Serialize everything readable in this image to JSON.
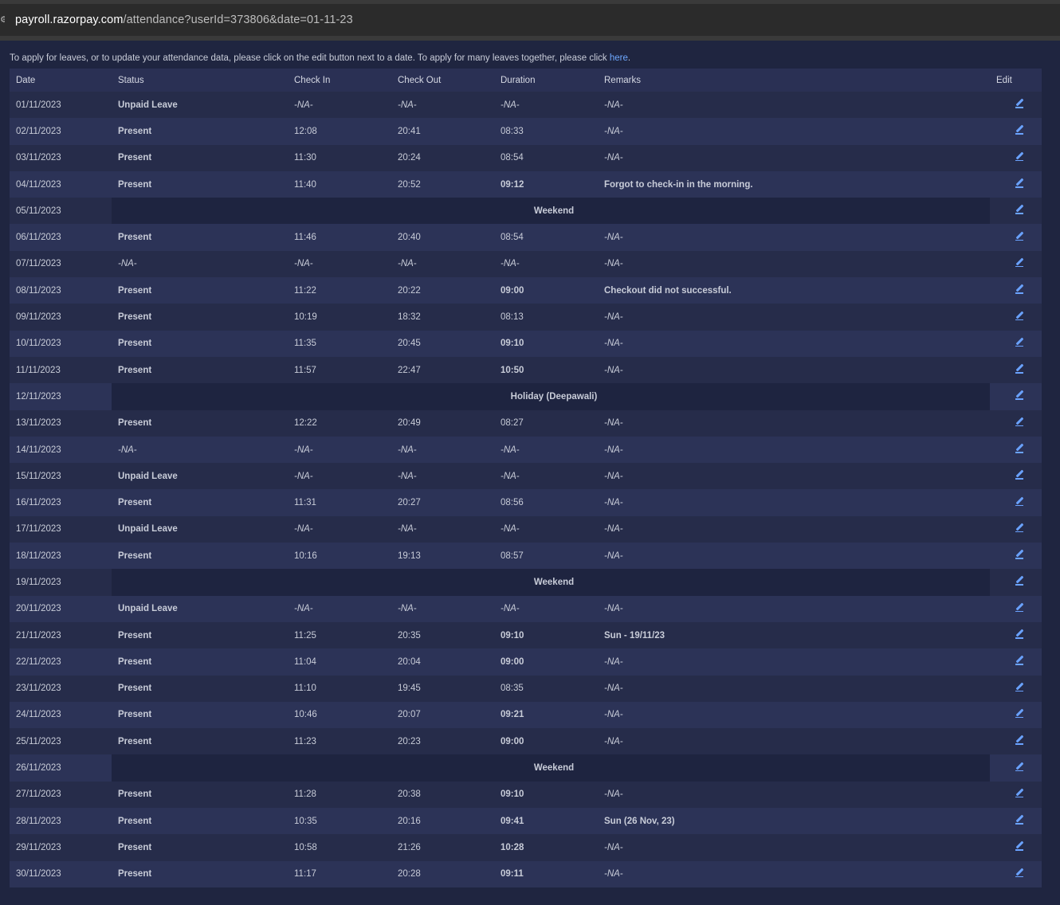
{
  "browser": {
    "url_domain": "payroll.razorpay.com",
    "url_path": "/attendance?userId=373806&date=01-11-23"
  },
  "notice": {
    "text": "To apply for leaves, or to update your attendance data, please click on the edit button next to a date. To apply for many leaves together, please click ",
    "link": "here",
    "end": "."
  },
  "table": {
    "headers": [
      "Date",
      "Status",
      "Check In",
      "Check Out",
      "Duration",
      "Remarks",
      "Edit"
    ],
    "rows": [
      {
        "date": "01/11/2023",
        "status": "Unpaid Leave",
        "in": "-NA-",
        "out": "-NA-",
        "dur": "-NA-",
        "remarks": "-NA-"
      },
      {
        "date": "02/11/2023",
        "status": "Present",
        "in": "12:08",
        "out": "20:41",
        "dur": "08:33",
        "remarks": "-NA-"
      },
      {
        "date": "03/11/2023",
        "status": "Present",
        "in": "11:30",
        "out": "20:24",
        "dur": "08:54",
        "remarks": "-NA-"
      },
      {
        "date": "04/11/2023",
        "status": "Present",
        "in": "11:40",
        "out": "20:52",
        "dur": "09:12",
        "remarks": "Forgot to check-in in the morning."
      },
      {
        "date": "05/11/2023",
        "special": "Weekend"
      },
      {
        "date": "06/11/2023",
        "status": "Present",
        "in": "11:46",
        "out": "20:40",
        "dur": "08:54",
        "remarks": "-NA-"
      },
      {
        "date": "07/11/2023",
        "status": "-NA-",
        "in": "-NA-",
        "out": "-NA-",
        "dur": "-NA-",
        "remarks": "-NA-"
      },
      {
        "date": "08/11/2023",
        "status": "Present",
        "in": "11:22",
        "out": "20:22",
        "dur": "09:00",
        "remarks": "Checkout did not successful."
      },
      {
        "date": "09/11/2023",
        "status": "Present",
        "in": "10:19",
        "out": "18:32",
        "dur": "08:13",
        "remarks": "-NA-"
      },
      {
        "date": "10/11/2023",
        "status": "Present",
        "in": "11:35",
        "out": "20:45",
        "dur": "09:10",
        "remarks": "-NA-"
      },
      {
        "date": "11/11/2023",
        "status": "Present",
        "in": "11:57",
        "out": "22:47",
        "dur": "10:50",
        "remarks": "-NA-"
      },
      {
        "date": "12/11/2023",
        "special": "Holiday (Deepawali)"
      },
      {
        "date": "13/11/2023",
        "status": "Present",
        "in": "12:22",
        "out": "20:49",
        "dur": "08:27",
        "remarks": "-NA-"
      },
      {
        "date": "14/11/2023",
        "status": "-NA-",
        "in": "-NA-",
        "out": "-NA-",
        "dur": "-NA-",
        "remarks": "-NA-"
      },
      {
        "date": "15/11/2023",
        "status": "Unpaid Leave",
        "in": "-NA-",
        "out": "-NA-",
        "dur": "-NA-",
        "remarks": "-NA-"
      },
      {
        "date": "16/11/2023",
        "status": "Present",
        "in": "11:31",
        "out": "20:27",
        "dur": "08:56",
        "remarks": "-NA-"
      },
      {
        "date": "17/11/2023",
        "status": "Unpaid Leave",
        "in": "-NA-",
        "out": "-NA-",
        "dur": "-NA-",
        "remarks": "-NA-"
      },
      {
        "date": "18/11/2023",
        "status": "Present",
        "in": "10:16",
        "out": "19:13",
        "dur": "08:57",
        "remarks": "-NA-"
      },
      {
        "date": "19/11/2023",
        "special": "Weekend"
      },
      {
        "date": "20/11/2023",
        "status": "Unpaid Leave",
        "in": "-NA-",
        "out": "-NA-",
        "dur": "-NA-",
        "remarks": "-NA-"
      },
      {
        "date": "21/11/2023",
        "status": "Present",
        "in": "11:25",
        "out": "20:35",
        "dur": "09:10",
        "remarks": "Sun - 19/11/23"
      },
      {
        "date": "22/11/2023",
        "status": "Present",
        "in": "11:04",
        "out": "20:04",
        "dur": "09:00",
        "remarks": "-NA-"
      },
      {
        "date": "23/11/2023",
        "status": "Present",
        "in": "11:10",
        "out": "19:45",
        "dur": "08:35",
        "remarks": "-NA-"
      },
      {
        "date": "24/11/2023",
        "status": "Present",
        "in": "10:46",
        "out": "20:07",
        "dur": "09:21",
        "remarks": "-NA-"
      },
      {
        "date": "25/11/2023",
        "status": "Present",
        "in": "11:23",
        "out": "20:23",
        "dur": "09:00",
        "remarks": "-NA-"
      },
      {
        "date": "26/11/2023",
        "special": "Weekend"
      },
      {
        "date": "27/11/2023",
        "status": "Present",
        "in": "11:28",
        "out": "20:38",
        "dur": "09:10",
        "remarks": "-NA-"
      },
      {
        "date": "28/11/2023",
        "status": "Present",
        "in": "10:35",
        "out": "20:16",
        "dur": "09:41",
        "remarks": "Sun (26 Nov, 23)"
      },
      {
        "date": "29/11/2023",
        "status": "Present",
        "in": "10:58",
        "out": "21:26",
        "dur": "10:28",
        "remarks": "-NA-"
      },
      {
        "date": "30/11/2023",
        "status": "Present",
        "in": "11:17",
        "out": "20:28",
        "dur": "09:11",
        "remarks": "-NA-"
      }
    ]
  },
  "colors": {
    "late_or_short": "#f05a5a",
    "on_time": "#5b9cf0",
    "link": "#6ea8ff",
    "page_bg": "#1f2540"
  },
  "icons": {
    "edit": "pencil-icon",
    "site": "site-info-icon"
  }
}
